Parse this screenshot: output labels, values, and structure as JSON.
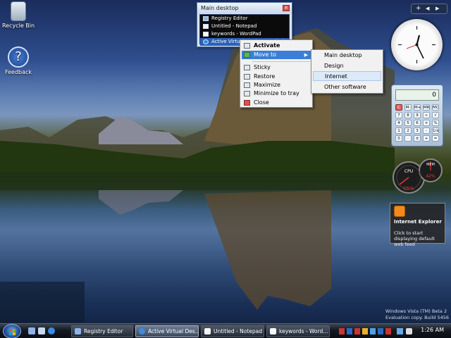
{
  "desktop": {
    "icons": [
      {
        "label": "Recycle Bin",
        "icon": "recycle-bin-icon"
      },
      {
        "label": "Feedback",
        "icon": "feedback-icon"
      }
    ]
  },
  "switcher": {
    "title": "Main desktop",
    "items": [
      {
        "label": "Registry Editor",
        "icon": "registry-editor-icon"
      },
      {
        "label": "Untitled - Notepad",
        "icon": "notepad-icon"
      },
      {
        "label": "keywords - WordPad",
        "icon": "wordpad-icon"
      },
      {
        "label": "Active Virtual Desktop - Windows Inte",
        "icon": "ie-icon"
      }
    ]
  },
  "context_menu": {
    "items": [
      {
        "label": "Activate",
        "icon": "activate-icon"
      },
      {
        "label": "Move to",
        "icon": "move-icon"
      },
      {
        "label": "Sticky",
        "icon": "sticky-icon"
      },
      {
        "label": "Restore",
        "icon": "restore-icon"
      },
      {
        "label": "Maximize",
        "icon": "maximize-icon"
      },
      {
        "label": "Minimize to tray",
        "icon": "minimize-tray-icon"
      },
      {
        "label": "Close",
        "icon": "close-icon"
      }
    ],
    "submenu": [
      "Main desktop",
      "Design",
      "Internet",
      "Other software"
    ]
  },
  "sidebar": {
    "clock_time": "1:26",
    "calculator": {
      "display": "0",
      "keys": [
        "C",
        "M-",
        "M+",
        "MR",
        "MC",
        "7",
        "8",
        "9",
        "÷",
        "√",
        "4",
        "5",
        "6",
        "×",
        "%",
        "1",
        "2",
        "3",
        "-",
        "1/x",
        "0",
        "·",
        "±",
        "+",
        "="
      ]
    },
    "cpu": {
      "cpu_label": "CPU",
      "cpu_value": "05%",
      "mem_label": "MEM",
      "mem_value": "42%"
    },
    "feed": {
      "title": "Internet Explorer",
      "body": "Click to start displaying default web feed"
    }
  },
  "watermark": {
    "line1": "Windows Vista (TM) Beta 2",
    "line2": "Evaluation copy. Build 5456"
  },
  "taskbar": {
    "buttons": [
      {
        "label": "Registry Editor",
        "icon": "registry-editor-icon"
      },
      {
        "label": "Active Virtual Des...",
        "icon": "ie-icon"
      },
      {
        "label": "Untitled - Notepad",
        "icon": "notepad-icon"
      },
      {
        "label": "keywords - Word...",
        "icon": "wordpad-icon"
      }
    ],
    "clock": "1:26 AM"
  }
}
